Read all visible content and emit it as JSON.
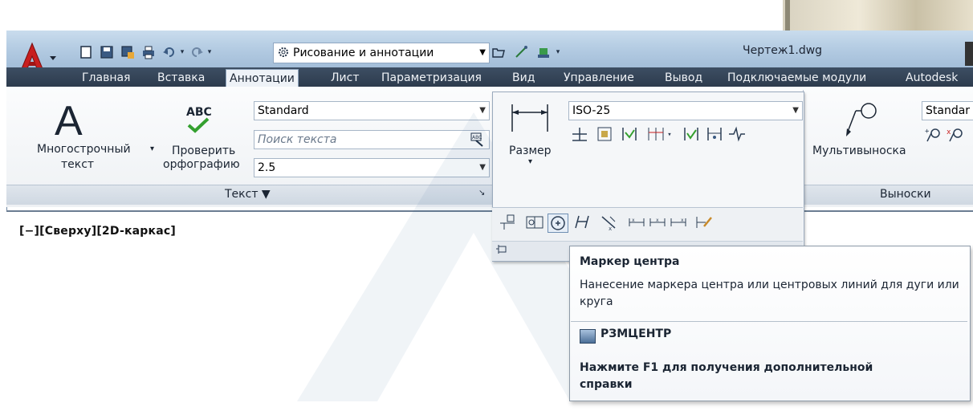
{
  "colors": {
    "title_gradient_top": "#c9dced",
    "tab_strip": "#2d3b4d",
    "accent_red": "#c81e1e",
    "check_green": "#34a02f"
  },
  "quick_access": {
    "icons": [
      "new-icon",
      "save-icon",
      "save-as-icon",
      "print-icon",
      "undo-icon",
      "redo-icon",
      "workspace-gear-icon",
      "open-icon",
      "match-icon",
      "plot-icon"
    ],
    "workspace": "Рисование и аннотации"
  },
  "window": {
    "title": "Чертеж1.dwg"
  },
  "tabs": [
    {
      "label": "Главная",
      "active": false
    },
    {
      "label": "Вставка",
      "active": false
    },
    {
      "label": "Аннотации",
      "active": true
    },
    {
      "label": "Лист",
      "active": false
    },
    {
      "label": "Параметризация",
      "active": false
    },
    {
      "label": "Вид",
      "active": false
    },
    {
      "label": "Управление",
      "active": false
    },
    {
      "label": "Вывод",
      "active": false
    },
    {
      "label": "Подключаемые модули",
      "active": false
    },
    {
      "label": "Autodesk",
      "active": false
    }
  ],
  "text_panel": {
    "mtext_line1": "Многострочный",
    "mtext_line2": "текст",
    "spell_line1": "Проверить",
    "spell_line2": "орфографию",
    "spell_icon_text": "ABC",
    "style_value": "Standard",
    "search_placeholder": "Поиск текста",
    "height_value": "2.5",
    "footer": "Текст ▼"
  },
  "dimension_panel": {
    "button_label": "Размер",
    "style_value": "ISO-25"
  },
  "leader_panel": {
    "button_label": "Мультивыноска",
    "style_value": "Standar",
    "footer": "Выноски"
  },
  "viewport": {
    "label": "[−][Сверху][2D-каркас]"
  },
  "tooltip": {
    "title": "Маркер центра",
    "description": "Нанесение маркера центра или центровых линий для дуги или круга",
    "command": "РЗМЦЕНТР",
    "help": "Нажмите F1 для получения дополнительной справки"
  }
}
